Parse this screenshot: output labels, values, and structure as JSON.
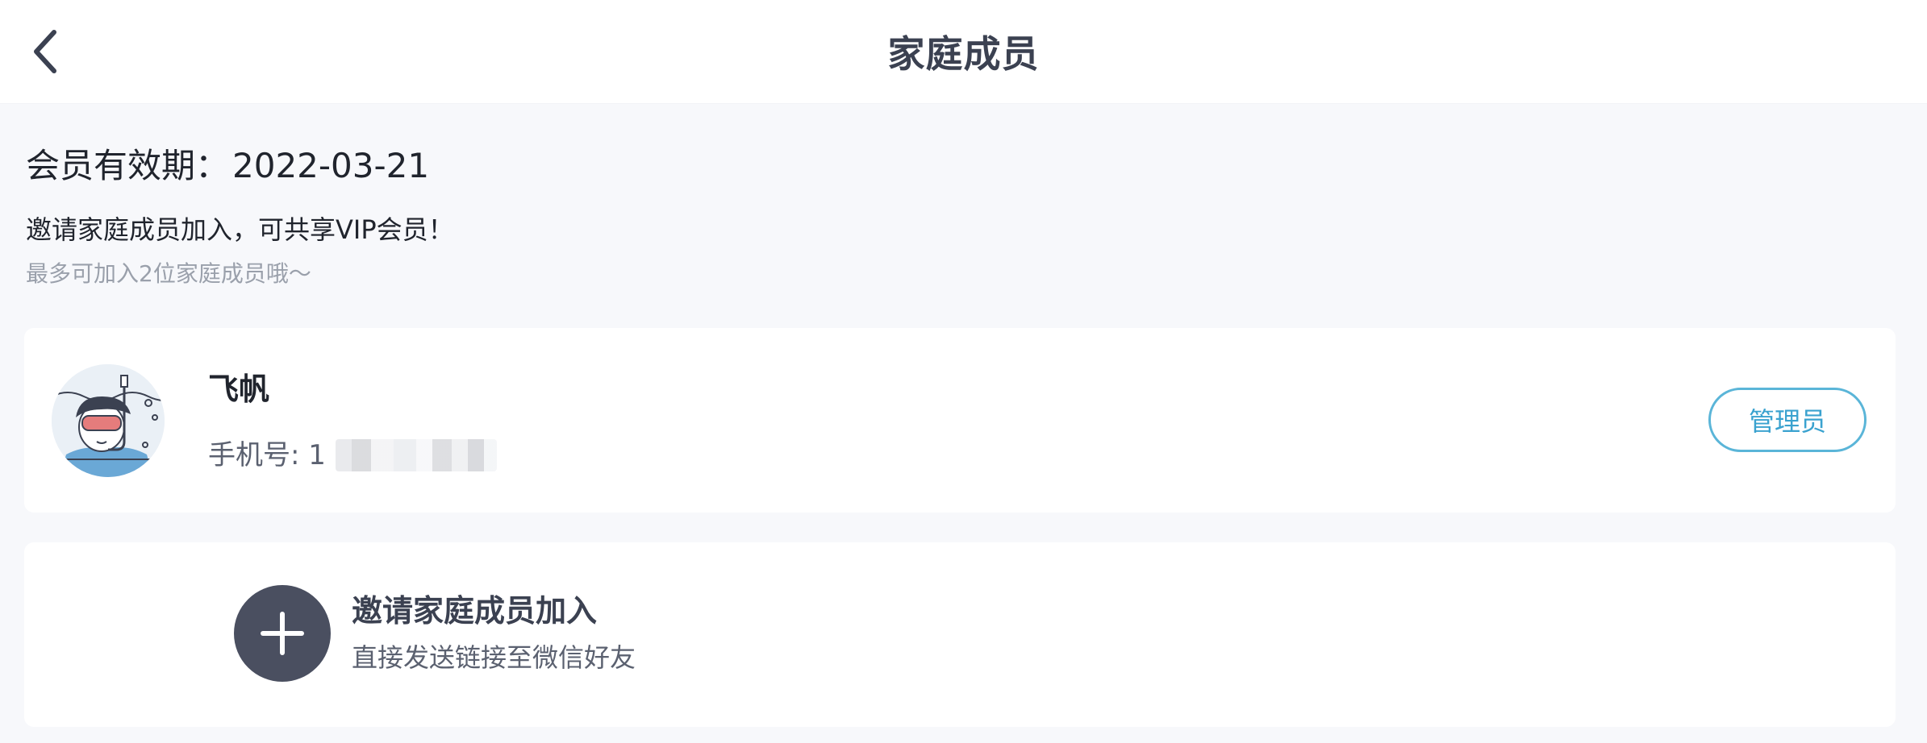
{
  "header": {
    "title": "家庭成员",
    "back_icon": "chevron-left-icon"
  },
  "membership": {
    "label": "会员有效期：",
    "value": "2022-03-21"
  },
  "info": {
    "invite_text": "邀请家庭成员加入，可共享VIP会员！",
    "limit_text": "最多可加入2位家庭成员哦～"
  },
  "member": {
    "name": "飞帆",
    "phone_label": "手机号: 1",
    "role": "管理员",
    "avatar_icon": "snorkel-diver-avatar"
  },
  "invite_card": {
    "title": "邀请家庭成员加入",
    "subtitle": "直接发送链接至微信好友",
    "icon": "plus-icon"
  },
  "colors": {
    "background": "#f7f8fb",
    "card": "#ffffff",
    "accent": "#3aa2cf",
    "plus_circle": "#4a4f60"
  }
}
